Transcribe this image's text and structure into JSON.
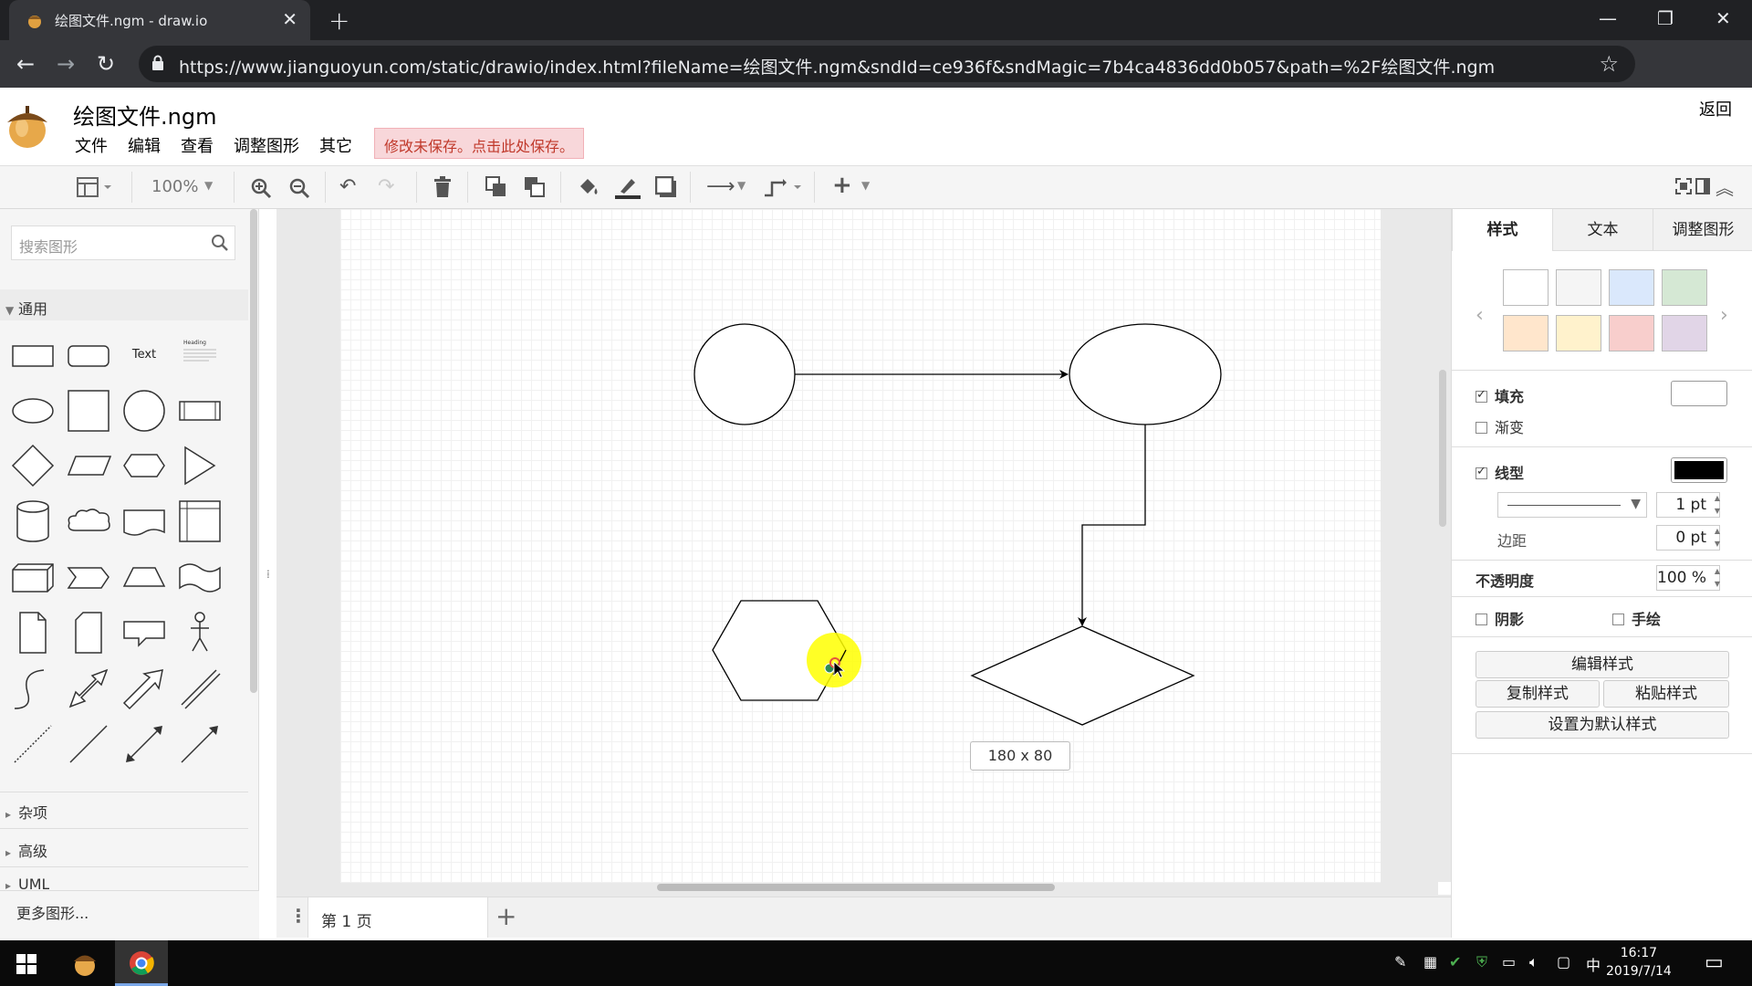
{
  "browser": {
    "tab_title": "绘图文件.ngm - draw.io",
    "tab_close": "✕",
    "new_tab": "+",
    "url": "https://www.jianguoyun.com/static/drawio/index.html?fileName=绘图文件.ngm&sndId=ce936f&sndMagic=7b4ca4836dd0b057&path=%2F绘图文件.ngm",
    "win_minimize": "—",
    "win_restore": "❐",
    "win_close": "✕",
    "star": "☆",
    "menu": "⋮"
  },
  "app": {
    "title": "绘图文件.ngm",
    "menus": [
      "文件",
      "编辑",
      "查看",
      "调整图形",
      "其它"
    ],
    "save_warning": "修改未保存。点击此处保存。",
    "back": "返回"
  },
  "toolbar": {
    "zoom": "100%"
  },
  "left_panel": {
    "search_placeholder": "搜索图形",
    "section_general": "通用",
    "text_shape": "Text",
    "heading_shape": "Heading",
    "section_misc": "杂项",
    "section_advanced": "高级",
    "section_uml": "UML",
    "more_shapes": "更多图形..."
  },
  "canvas": {
    "size_tooltip": "180 x 80"
  },
  "pages": {
    "current": "第 1 页"
  },
  "right_panel": {
    "tabs": [
      "样式",
      "文本",
      "调整图形"
    ],
    "palette": [
      "#ffffff",
      "#f5f5f5",
      "#dae8fc",
      "#d5e8d4",
      "#ffe6cc",
      "#fff2cc",
      "#f8cecc",
      "#e1d5e7"
    ],
    "fill_label": "填充",
    "fill_color": "#ffffff",
    "gradient_label": "渐变",
    "line_label": "线型",
    "line_color": "#000000",
    "line_width": "1 pt",
    "spacing_label": "边距",
    "spacing_value": "0 pt",
    "opacity_label": "不透明度",
    "opacity_value": "100 %",
    "shadow_label": "阴影",
    "sketch_label": "手绘",
    "edit_style": "编辑样式",
    "copy_style": "复制样式",
    "paste_style": "粘贴样式",
    "set_default": "设置为默认样式"
  },
  "taskbar": {
    "time": "16:17",
    "date": "2019/7/14",
    "ime": "中"
  }
}
